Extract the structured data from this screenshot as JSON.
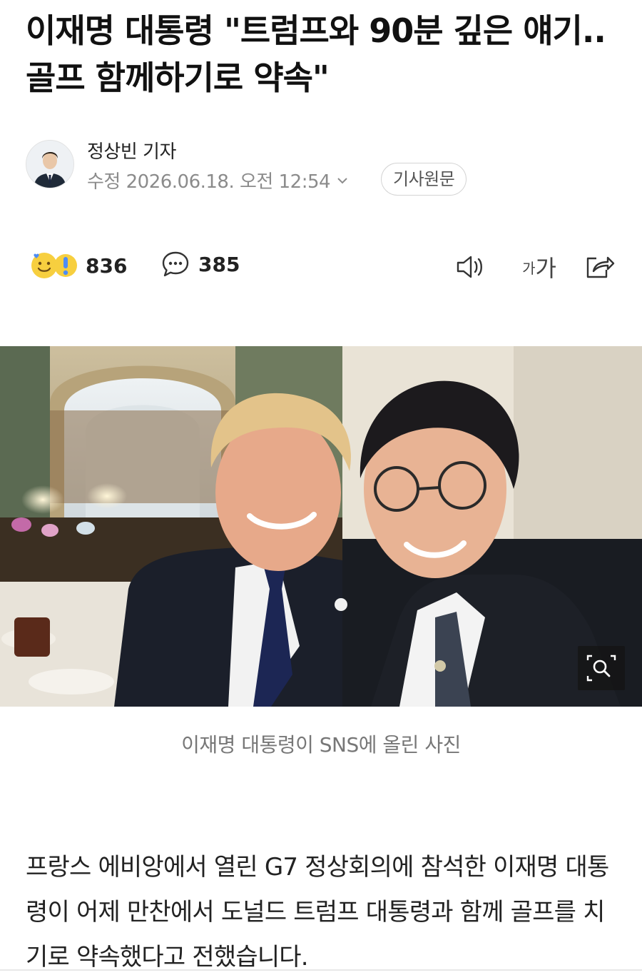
{
  "article": {
    "headline": "이재명 대통령 \"트럼프와 90분 깊은 얘기..골프 함께하기로 약속\"",
    "reporter": "정상빈 기자",
    "date_text": "수정 2026.06.18. 오전 12:54",
    "original_button": "기사원문"
  },
  "actions": {
    "reaction_count": "836",
    "comment_count": "385",
    "font_size_small": "가",
    "font_size_large": "가"
  },
  "photo": {
    "caption": "이재명 대통령이 SNS에 올린 사진"
  },
  "body": {
    "paragraph": "프랑스 에비앙에서 열린 G7 정상회의에 참석한 이재명 대통령이 어제 만찬에서 도널드 트럼프 대통령과 함께 골프를 치기로 약속했다고 전했습니다."
  },
  "colors": {
    "emoji_yellow": "#f7cf3f",
    "emoji_blue": "#4d8cf5",
    "text_gray": "#8b8b8b"
  },
  "icons": {
    "reaction": "smile-emoji-icon",
    "comment": "comment-bubble-icon",
    "audio": "speaker-icon",
    "font": "font-size-icon",
    "share": "share-icon",
    "zoom": "zoom-search-icon",
    "date_expand": "chevron-down-icon"
  }
}
